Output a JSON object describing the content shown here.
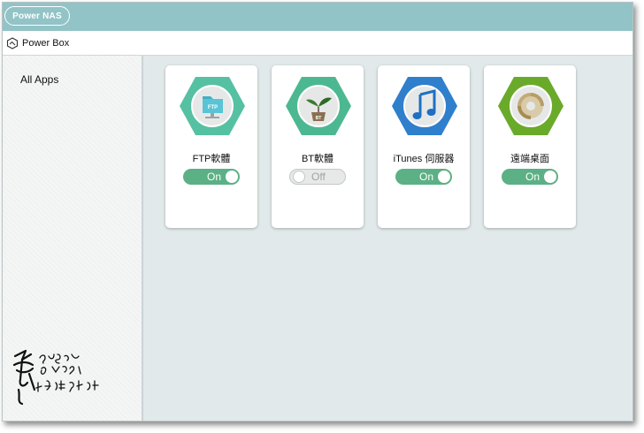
{
  "header": {
    "logo_text": "Power NAS",
    "section_title": "Power Box"
  },
  "sidebar": {
    "items": [
      {
        "label": "All Apps"
      }
    ]
  },
  "apps": [
    {
      "name": "FTP軟體",
      "status": "On",
      "icon": "ftp-folder-icon",
      "color": "#55c1a2"
    },
    {
      "name": "BT軟體",
      "status": "Off",
      "icon": "bt-sprout-icon",
      "color": "#4cb892"
    },
    {
      "name": "iTunes 伺服器",
      "status": "On",
      "icon": "itunes-note-icon",
      "color": "#2f7fcd"
    },
    {
      "name": "遠端桌面",
      "status": "On",
      "icon": "remote-desktop-icon",
      "color": "#6aaa2a"
    }
  ],
  "colors": {
    "topbar": "#92c3c6",
    "toggle_on": "#5cb085",
    "toggle_off": "#e7e9e9",
    "main_bg": "#e1e9ea"
  }
}
